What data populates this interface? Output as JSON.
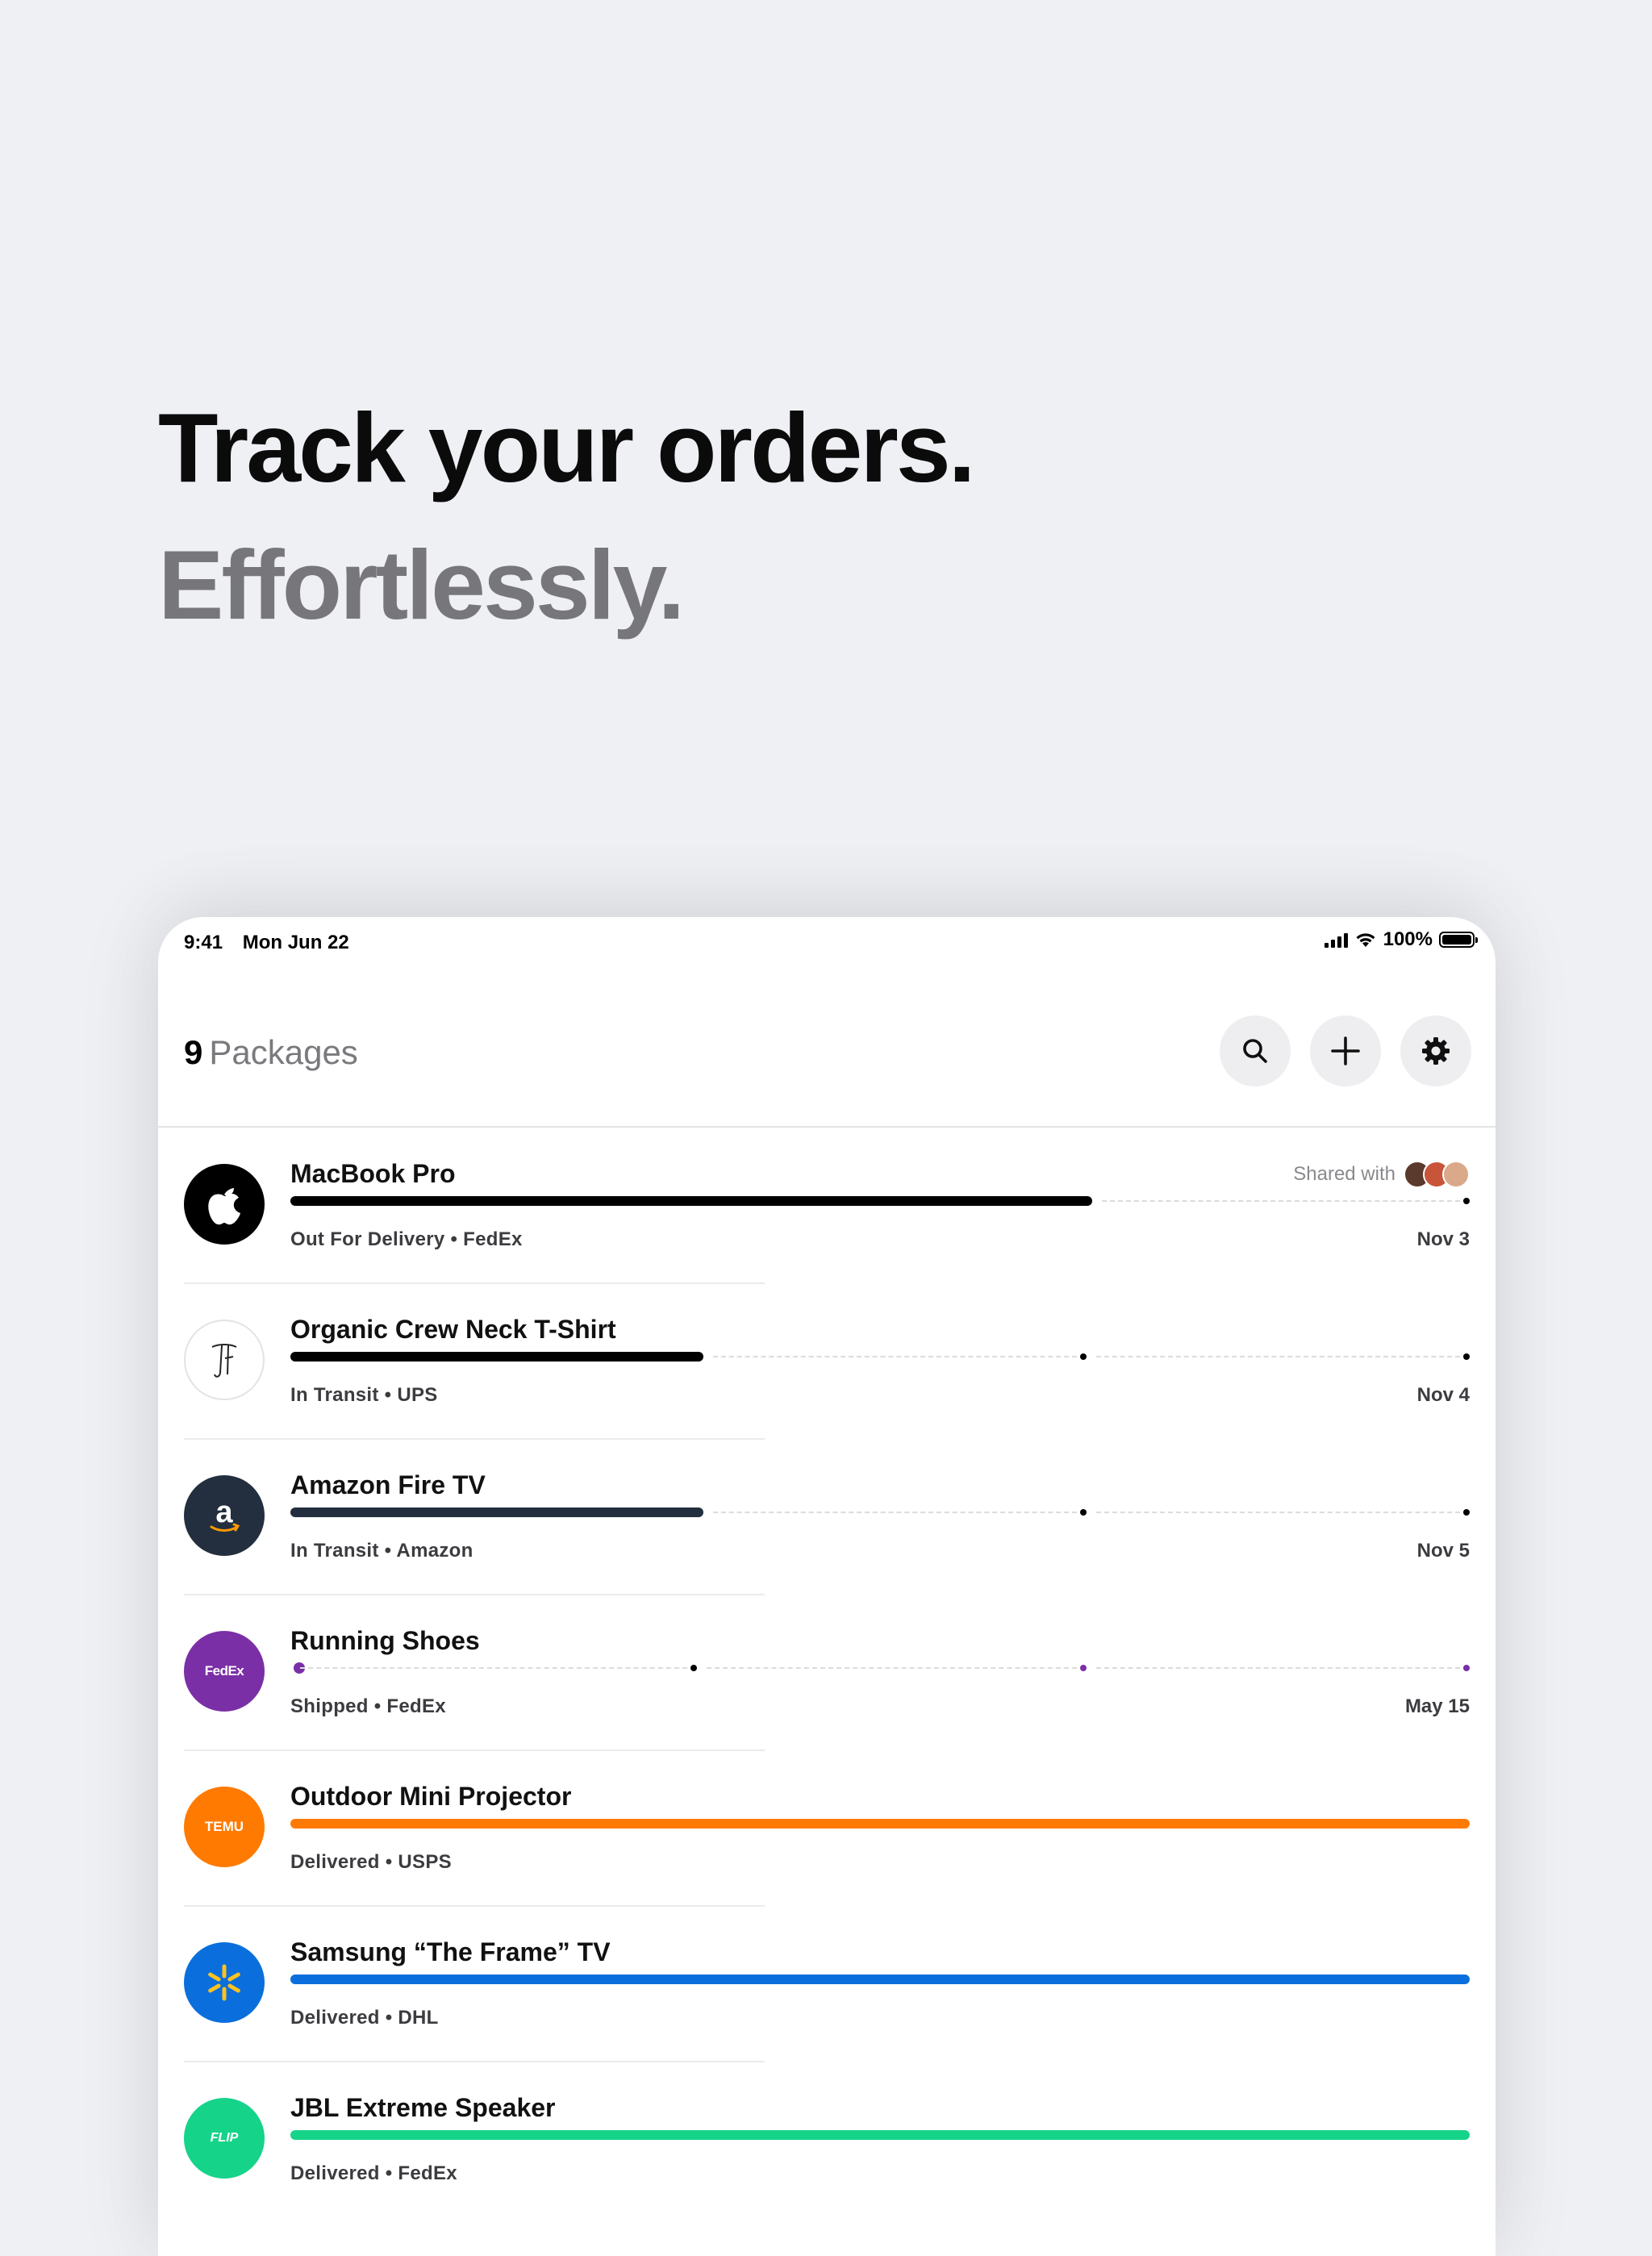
{
  "headline": {
    "line1": "Track your orders.",
    "line2": "Effortlessly."
  },
  "status_bar": {
    "time": "9:41",
    "date": "Mon Jun 22",
    "battery": "100%"
  },
  "header": {
    "count": "9",
    "label": "Packages"
  },
  "icons": {
    "search": "search-icon",
    "add": "plus-icon",
    "settings": "gear-icon"
  },
  "packages": [
    {
      "name": "MacBook Pro",
      "status": "Out For Delivery • FedEx",
      "date": "Nov 3",
      "shared_label": "Shared with",
      "progress": 0.68,
      "color": "#000000",
      "logo": "apple-logo"
    },
    {
      "name": "Organic Crew Neck T-Shirt",
      "status": "In Transit • UPS",
      "date": "Nov 4",
      "progress": 0.35,
      "color": "#000000",
      "logo": "brand-monogram-logo"
    },
    {
      "name": "Amazon Fire TV",
      "status": "In Transit • Amazon",
      "date": "Nov 5",
      "progress": 0.35,
      "color": "#232f3e",
      "logo": "amazon-logo"
    },
    {
      "name": "Running Shoes",
      "status": "Shipped • FedEx",
      "date": "May 15",
      "progress": 0.0,
      "color": "#7b2fa6",
      "logo": "fedex-logo",
      "logo_text": "FedEx"
    },
    {
      "name": "Outdoor Mini Projector",
      "status": "Delivered • USPS",
      "progress": 1.0,
      "color": "#ff7a00",
      "logo": "temu-logo",
      "logo_text": "TEMU"
    },
    {
      "name": "Samsung “The Frame” TV",
      "status": "Delivered • DHL",
      "progress": 1.0,
      "color": "#0a6fdd",
      "logo": "walmart-logo"
    },
    {
      "name": "JBL Extreme Speaker",
      "status": "Delivered • FedEx",
      "progress": 1.0,
      "color": "#16d38a",
      "logo": "flip-logo",
      "logo_text": "FLIP"
    }
  ]
}
